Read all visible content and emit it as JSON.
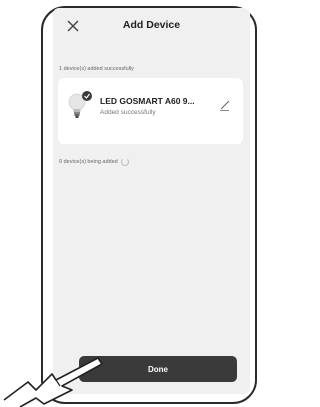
{
  "header": {
    "title": "Add Device",
    "close_icon": "close-icon"
  },
  "status": {
    "added": "1 device(s) added successfully",
    "adding": "0 device(s) being added"
  },
  "device": {
    "name": "LED GOSMART A60 9...",
    "status": "Added successfully",
    "icon": "bulb-icon"
  },
  "footer": {
    "done_label": "Done"
  }
}
